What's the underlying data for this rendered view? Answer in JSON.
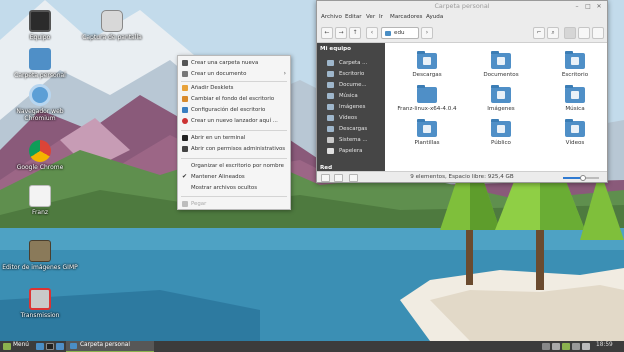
{
  "desktop": {
    "icons": [
      {
        "label": "Equipo",
        "icon": "computer-icon"
      },
      {
        "label": "Captura de pantalla",
        "icon": "camera-icon"
      },
      {
        "label": "Carpeta personal",
        "icon": "home-folder-icon"
      },
      {
        "label": "Navegador web Chromium",
        "icon": "chromium-icon"
      },
      {
        "label": "Google Chrome",
        "icon": "chrome-icon"
      },
      {
        "label": "Franz",
        "icon": "franz-icon"
      },
      {
        "label": "Editor de imágenes GIMP",
        "icon": "gimp-icon"
      },
      {
        "label": "Transmission",
        "icon": "transmission-icon"
      }
    ]
  },
  "context_menu": {
    "items": [
      {
        "label": "Crear una carpeta nueva",
        "icon": "folder-new-icon"
      },
      {
        "label": "Crear un documento",
        "icon": "document-new-icon",
        "submenu": "›"
      },
      {
        "label": "Añadir Desklets",
        "icon": "desklet-icon"
      },
      {
        "label": "Cambiar el fondo del escritorio",
        "icon": "wallpaper-icon"
      },
      {
        "label": "Configuración del escritorio",
        "icon": "settings-icon"
      },
      {
        "label": "Crear un nuevo lanzador aquí ...",
        "icon": "launcher-icon"
      },
      {
        "label": "Abrir en un terminal",
        "icon": "terminal-icon"
      },
      {
        "label": "Abrir con permisos administrativos",
        "icon": "admin-icon"
      },
      {
        "label": "Organizar el escritorio por nombre",
        "icon": ""
      },
      {
        "label": "Mantener Alineados",
        "icon": "check-icon",
        "checked": true,
        "check": "✔"
      },
      {
        "label": "Mostrar archivos ocultos",
        "icon": ""
      },
      {
        "label": "Pegar",
        "icon": "paste-icon",
        "disabled": true
      }
    ]
  },
  "file_manager": {
    "title": "Carpeta personal",
    "window_buttons": {
      "minimize": "–",
      "maximize": "□",
      "close": "✕"
    },
    "menu": [
      "Archivo",
      "Editar",
      "Ver",
      "Ir",
      "Marcadores",
      "Ayuda"
    ],
    "toolbar": {
      "back": "←",
      "forward": "→",
      "up": "↑",
      "prev_crumb": "‹",
      "path": "edu",
      "next_crumb": "›",
      "terminal": "⌐",
      "search": "⌕"
    },
    "sidebar": {
      "header": "Mi equipo",
      "items": [
        "Carpeta ...",
        "Escritorio",
        "Docume...",
        "Música",
        "Imágenes",
        "Vídeos",
        "Descargas",
        "Sistema ...",
        "Papelera"
      ],
      "footer_header": "Red"
    },
    "files": [
      {
        "name": "Descargas",
        "icon": "download-folder-icon"
      },
      {
        "name": "Documentos",
        "icon": "documents-folder-icon"
      },
      {
        "name": "Escritorio",
        "icon": "desktop-folder-icon"
      },
      {
        "name": "Franz-linux-x64-4.0.4",
        "icon": "folder-icon"
      },
      {
        "name": "Imágenes",
        "icon": "pictures-folder-icon"
      },
      {
        "name": "Música",
        "icon": "music-folder-icon"
      },
      {
        "name": "Plantillas",
        "icon": "templates-folder-icon"
      },
      {
        "name": "Público",
        "icon": "public-folder-icon"
      },
      {
        "name": "Vídeos",
        "icon": "videos-folder-icon"
      }
    ],
    "status": "9 elementos, Espacio libre: 925,4 GB",
    "zoom_level": 0.55
  },
  "taskbar": {
    "menu_label": "Menú",
    "task_label": "Carpeta personal",
    "clock": "18:59"
  },
  "colors": {
    "folder_blue": "#4f8fc7",
    "sidebar_bg": "#464646",
    "panel_bg": "#3c3c3c",
    "accent_green": "#8bb24e",
    "zoom_blue": "#2f7ad1"
  }
}
